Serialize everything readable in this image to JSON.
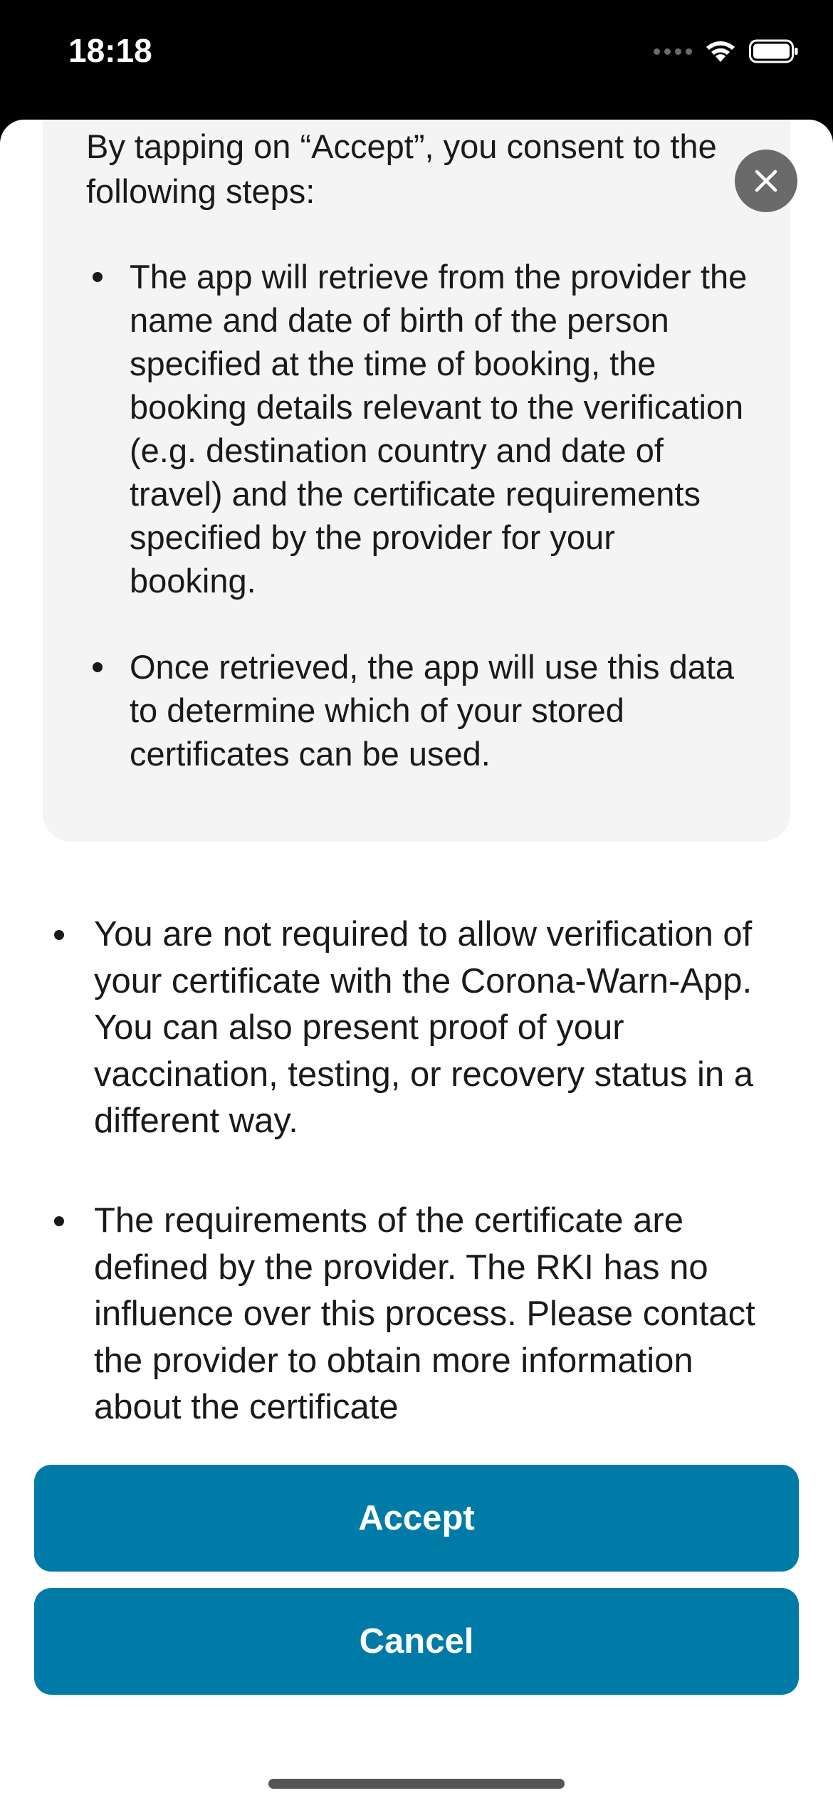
{
  "status_bar": {
    "time": "18:18",
    "icons": [
      "cellular-signal-icon",
      "wifi-icon",
      "battery-icon"
    ]
  },
  "info_card": {
    "intro": "By tapping on “Accept”, you consent to the following steps:",
    "items": [
      "The app will retrieve from the provider the name and date of birth of the person specified at the time of booking, the booking details relevant to the verification (e.g. destination country and date of travel) and the certificate requirements specified by the provider for your booking.",
      "Once retrieved, the app will use this data to determine which of your stored certificates can be used."
    ],
    "close_icon": "close-icon"
  },
  "notes": {
    "items": [
      "You are not required to allow verification of your certificate with the Corona-Warn-App. You can also present proof of your vaccination, testing, or recovery status in a different way.",
      "The requirements of the certificate are defined by the provider. The RKI has no influence over this process. Please contact the provider to obtain more information about the certificate"
    ]
  },
  "buttons": {
    "accept_label": "Accept",
    "cancel_label": "Cancel"
  },
  "colors": {
    "accent": "#007ba7",
    "card_background": "#f4f4f4",
    "close_button": "#6a6a6a"
  }
}
